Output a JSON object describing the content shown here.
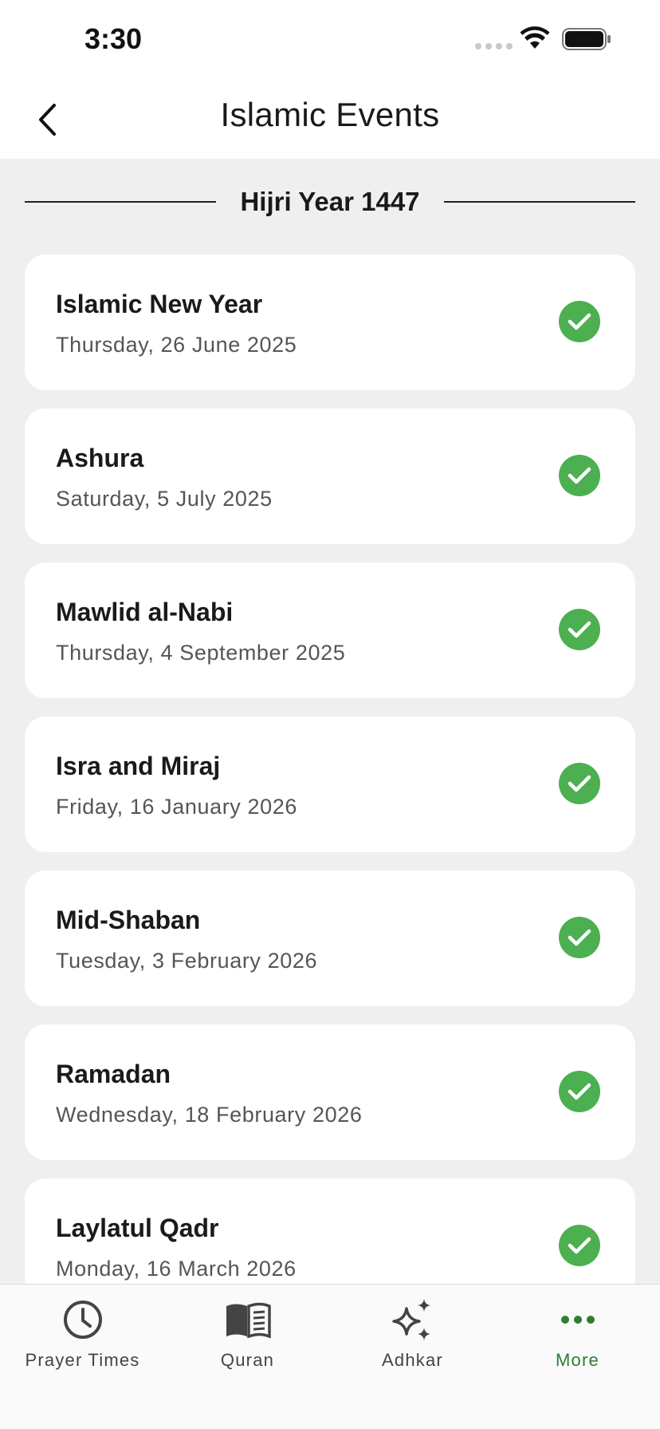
{
  "status_bar": {
    "time": "3:30"
  },
  "header": {
    "title": "Islamic Events"
  },
  "year_section": {
    "label": "Hijri Year 1447"
  },
  "events": [
    {
      "name": "Islamic New Year",
      "date": "Thursday, 26 June 2025",
      "status": "passed"
    },
    {
      "name": "Ashura",
      "date": "Saturday, 5 July 2025",
      "status": "passed"
    },
    {
      "name": "Mawlid al-Nabi",
      "date": "Thursday, 4 September 2025",
      "status": "passed"
    },
    {
      "name": "Isra and Miraj",
      "date": "Friday, 16 January 2026",
      "status": "passed"
    },
    {
      "name": "Mid-Shaban",
      "date": "Tuesday, 3 February 2026",
      "status": "passed"
    },
    {
      "name": "Ramadan",
      "date": "Wednesday, 18 February 2026",
      "status": "passed"
    },
    {
      "name": "Laylatul Qadr",
      "date": "Monday, 16 March 2026",
      "status": "passed"
    }
  ],
  "tabs": [
    {
      "label": "Prayer Times",
      "icon": "clock-icon",
      "active": false
    },
    {
      "label": "Quran",
      "icon": "book-icon",
      "active": false
    },
    {
      "label": "Adhkar",
      "icon": "sparkles-icon",
      "active": false
    },
    {
      "label": "More",
      "icon": "more-dots-icon",
      "active": true
    }
  ],
  "colors": {
    "accent": "#2e7d32",
    "check": "#4caf50",
    "background": "#efefef"
  }
}
